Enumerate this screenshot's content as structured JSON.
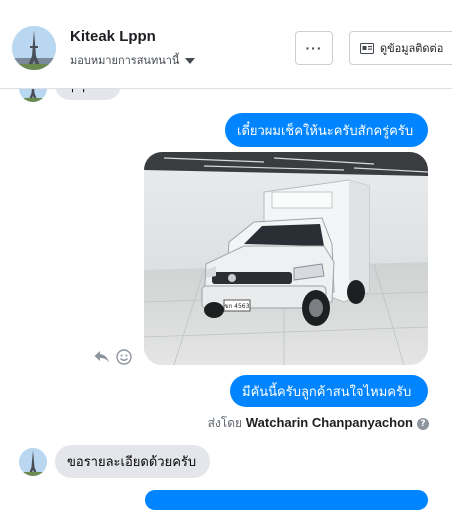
{
  "header": {
    "page_name": "Kiteak Lppn",
    "assign_label": "มอบหมายการสนทนานี้",
    "more_label": "···",
    "contact_label": "ดูข้อมูลติดต่อ"
  },
  "messages": {
    "top_partial": "ๆ ๆ",
    "out_1": "เดี๋ยวผมเช็คให้นะครับสักครู่ครับ",
    "out_2": "มีคันนี้ครับลูกค้าสนใจไหมครับ",
    "sent_by_prefix": "ส่งโดย",
    "sent_by_name": "Watcharin Chanpanyachon",
    "in_1": "ขอรายละเอียดด้วยครับ"
  },
  "photo": {
    "plate": "ขก 4563"
  },
  "icons": {
    "reply": "reply-icon",
    "react": "smiley-icon",
    "help": "help-icon",
    "contact": "id-card-icon",
    "caret": "caret-down-icon"
  },
  "colors": {
    "outgoing_bubble": "#0084ff",
    "incoming_bubble": "#e4e6eb"
  }
}
